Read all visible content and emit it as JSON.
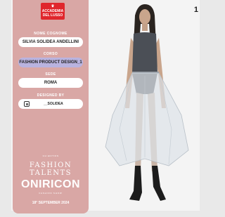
{
  "logo": {
    "line1": "ACCADEMIA",
    "line2": "DEL LUSSO"
  },
  "fields": {
    "name_label": "NOME COGNOME",
    "name_value": "SILVIA SOLIDEA ANDELLINI",
    "course_label": "CORSO",
    "course_value": "FASHION PRODUCT DESIGN_1",
    "location_label": "SEDE",
    "location_value": "ROMA",
    "designed_by_label": "DESIGNED BY",
    "instagram_handle": "__SOLIDEA"
  },
  "event": {
    "edition": "3rd EDITION",
    "fashion_talents": "FASHION TALENTS",
    "title": "ONIRICON",
    "subtitle": "FASHION SHOW",
    "date": "18° SEPTEMBER 2024"
  },
  "page_number": "1",
  "colors": {
    "panel": "#d9a7a5",
    "logo": "#e0262c",
    "course_pill": "#b9b3df"
  },
  "icons": {
    "social": "instagram-icon"
  }
}
